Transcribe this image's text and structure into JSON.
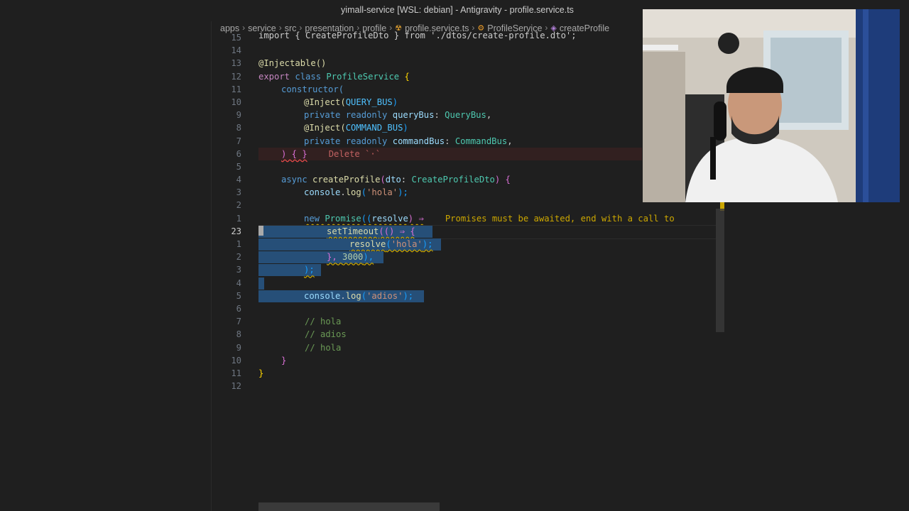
{
  "window": {
    "title": "yimall-service [WSL: debian] - Antigravity - profile.service.ts"
  },
  "breadcrumb": {
    "items": [
      "apps",
      "service",
      "src",
      "presentation",
      "profile",
      "profile.service.ts",
      "ProfileService",
      "createProfile"
    ]
  },
  "code": {
    "line_15": {
      "num": "15",
      "text": "import { CreateProfileDto } from './dtos/create-profile.dto';"
    },
    "line_14": {
      "num": "14"
    },
    "line_13": {
      "num": "13",
      "text": "@Injectable()"
    },
    "line_12a": {
      "num": "12",
      "kw_export": "export",
      "kw_class": "class",
      "name": "ProfileService",
      "brace": "{"
    },
    "line_11a": {
      "num": "11",
      "text": "constructor("
    },
    "line_10a": {
      "num": "10",
      "dec": "@Inject(",
      "cst": "QUERY_BUS",
      "close": ")"
    },
    "line_9a": {
      "num": "9",
      "mods": "private readonly ",
      "var": "queryBus",
      "colon": ": ",
      "type": "QueryBus",
      "comma": ","
    },
    "line_8a": {
      "num": "8",
      "dec": "@Inject(",
      "cst": "COMMAND_BUS",
      "close": ")"
    },
    "line_7a": {
      "num": "7",
      "mods": "private readonly ",
      "var": "commandBus",
      "colon": ": ",
      "type": "CommandBus",
      "comma": ","
    },
    "line_6": {
      "num": "6",
      "text": ") { }",
      "ghost": "Delete `·`"
    },
    "line_5a": {
      "num": "5"
    },
    "line_4": {
      "num": "4",
      "kw": "async ",
      "fn": "createProfile",
      "open": "(",
      "param": "dto",
      "colon": ": ",
      "type": "CreateProfileDto",
      "close": ") {"
    },
    "line_3": {
      "num": "3",
      "obj": "console",
      "dot": ".",
      "fn": "log",
      "open": "(",
      "str": "'hola'",
      "close": ");"
    },
    "line_2": {
      "num": "2"
    },
    "line_1": {
      "num": "1",
      "kw": "new ",
      "type": "Promise",
      "open": "((",
      "param": "resolve",
      "arrow": ") ⇒",
      "diagnostic": "Promises must be awaited, end with a call to"
    },
    "line_23": {
      "num": "23",
      "fn": "setTimeout",
      "open": "(() ⇒ {"
    },
    "line_r1": {
      "num": "1",
      "fn": "resolve",
      "open": "(",
      "str": "'hola'",
      "close": ");"
    },
    "line_r2": {
      "num": "2",
      "close": "},",
      "num_val": "3000",
      "tail": "),"
    },
    "line_r3": {
      "num": "3",
      "text": ");"
    },
    "line_r4": {
      "num": "4"
    },
    "line_r5": {
      "num": "5",
      "obj": "console",
      "dot": ".",
      "fn": "log",
      "open": "(",
      "str": "'adios'",
      "close": ");"
    },
    "line_r6": {
      "num": "6"
    },
    "line_r7": {
      "num": "7",
      "text": "// hola"
    },
    "line_r8": {
      "num": "8",
      "text": "// adios"
    },
    "line_r9": {
      "num": "9",
      "text": "// hola"
    },
    "line_r10": {
      "num": "10",
      "text": "}"
    },
    "line_r11": {
      "num": "11",
      "text": "}"
    },
    "line_r12": {
      "num": "12"
    }
  },
  "colors": {
    "editor_bg": "#1f1f1f",
    "selection": "#264f78",
    "warning": "#cca700",
    "keyword": "#569cd6",
    "type": "#4ec9b0",
    "string": "#ce9178",
    "comment": "#6a9955"
  },
  "webcam": {
    "description_icon": "webcam-person-icon"
  }
}
